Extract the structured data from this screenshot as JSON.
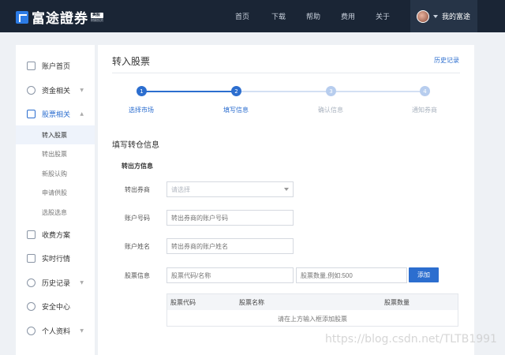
{
  "header": {
    "logo_text": "富途證券",
    "logo_badge": "美股",
    "logo_subtext": "财顾投资",
    "nav": [
      "首页",
      "下载",
      "帮助",
      "费用",
      "关于"
    ],
    "user_label": "我的富途"
  },
  "sidebar": {
    "items": [
      {
        "label": "账户首页",
        "icon": "account-home-icon"
      },
      {
        "label": "资金相关",
        "icon": "funds-icon",
        "caret": "▼"
      },
      {
        "label": "股票相关",
        "icon": "stocks-icon",
        "caret": "▲"
      },
      {
        "label": "收费方案",
        "icon": "fees-icon"
      },
      {
        "label": "实时行情",
        "icon": "market-icon"
      },
      {
        "label": "历史记录",
        "icon": "history-icon",
        "caret": "▼"
      },
      {
        "label": "安全中心",
        "icon": "shield-icon"
      },
      {
        "label": "个人资料",
        "icon": "profile-icon",
        "caret": "▼"
      }
    ],
    "sub_items": [
      "转入股票",
      "转出股票",
      "新股认购",
      "申请供股",
      "选股选息"
    ]
  },
  "main": {
    "title": "转入股票",
    "history_link": "历史记录",
    "steps": [
      {
        "num": "1",
        "label": "选择市场"
      },
      {
        "num": "2",
        "label": "填写信息"
      },
      {
        "num": "3",
        "label": "确认信息"
      },
      {
        "num": "4",
        "label": "通知券商"
      }
    ],
    "section_title": "填写转仓信息",
    "sub_title": "转出方信息",
    "fields": {
      "broker_label": "转出券商",
      "broker_placeholder": "请选择",
      "account_no_label": "账户号码",
      "account_no_placeholder": "转出券商的账户号码",
      "account_name_label": "账户姓名",
      "account_name_placeholder": "转出券商的账户姓名",
      "stock_info_label": "股票信息",
      "stock_code_placeholder": "股票代码/名称",
      "stock_qty_placeholder": "股票数量,例如:500"
    },
    "add_button": "添加",
    "table": {
      "headers": [
        "股票代码",
        "股票名称",
        "股票数量"
      ],
      "empty_text": "请在上方输入框添加股票"
    }
  },
  "watermark": "https://blog.csdn.net/TLTB1991",
  "colors": {
    "accent": "#2c6ecf",
    "header_bg": "#1a2535",
    "step_inactive": "#b7cdee"
  }
}
